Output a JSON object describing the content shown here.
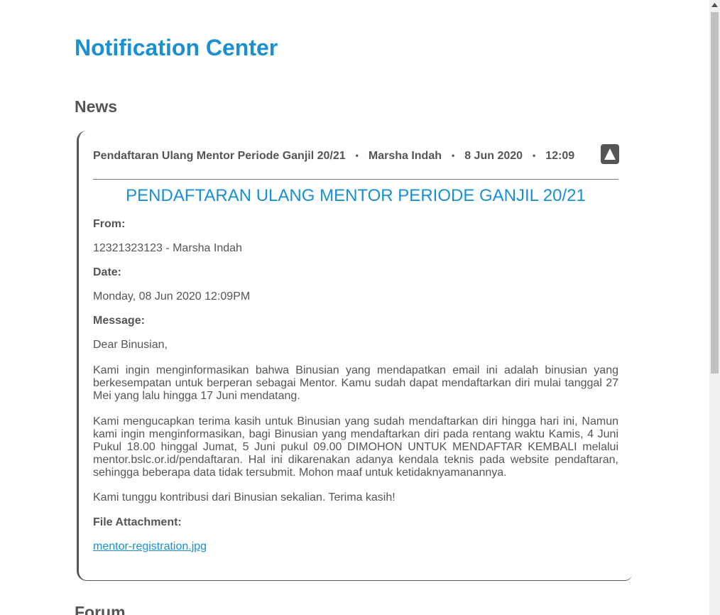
{
  "page": {
    "title": "Notification Center"
  },
  "sections": {
    "news": "News",
    "forum": "Forum"
  },
  "notification": {
    "header": {
      "subject": "Pendaftaran Ulang Mentor Periode Ganjil 20/21",
      "separator": "•",
      "sender": "Marsha Indah",
      "date": "8 Jun 2020",
      "time": "12:09"
    },
    "collapse_icon": "triangle-up-icon",
    "title": "PENDAFTARAN ULANG MENTOR PERIODE GANJIL 20/21",
    "from_label": "From:",
    "from_value": "12321323123 - Marsha Indah",
    "date_label": "Date:",
    "date_value": "Monday, 08 Jun 2020 12:09PM",
    "message_label": "Message:",
    "message": {
      "greeting": "Dear Binusian,",
      "paragraph1": "Kami ingin menginformasikan bahwa Binusian yang mendapatkan email ini adalah binusian yang berkesempatan untuk berperan sebagai Mentor. Kamu sudah dapat mendaftarkan diri mulai tanggal 27 Mei yang lalu hingga 17 Juni mendatang.",
      "paragraph2": "Kami mengucapkan terima kasih untuk Binusian yang sudah mendaftarkan diri hingga hari ini, Namun kami ingin menginformasikan, bagi Binusian yang mendaftarkan diri pada rentang waktu Kamis, 4 Juni Pukul 18.00 hinggal Jumat, 5 Juni pukul 09.00 DIMOHON UNTUK MENDAFTAR KEMBALI melalui mentor.bslc.or.id/pendaftaran. Hal ini dikarenakan adanya kendala teknis pada website pendaftaran, sehingga beberapa data tidak tersubmit. Mohon maaf untuk ketidaknyamanannya.",
      "closing": "Kami tunggu kontribusi dari Binusian sekalian. Terima kasih!"
    },
    "attachment_label": "File Attachment:",
    "attachment_file": "mentor-registration.jpg"
  },
  "colors": {
    "accent": "#1a8fd1",
    "text": "#555555",
    "background": "#ffffff"
  }
}
